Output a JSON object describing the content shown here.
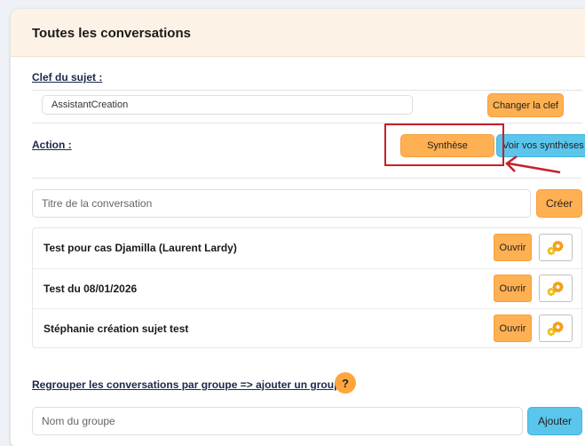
{
  "panel": {
    "title": "Toutes les conversations"
  },
  "subject": {
    "label": "Clef du sujet :",
    "value": "AssistantCreation",
    "change_button": "Changer la clef"
  },
  "action": {
    "label": "Action :",
    "synthesis_button": "Synthèse",
    "view_syntheses_button": "Voir vos synthèses"
  },
  "new_conversation": {
    "placeholder": "Titre de la conversation",
    "create_button": "Créer"
  },
  "conversations": [
    {
      "title": "Test pour cas Djamilla (Laurent Lardy)",
      "open_label": "Ouvrir",
      "icon": "gears-icon"
    },
    {
      "title": "Test du 08/01/2026",
      "open_label": "Ouvrir",
      "icon": "gears-icon"
    },
    {
      "title": "Stéphanie création sujet test",
      "open_label": "Ouvrir",
      "icon": "gears-icon"
    }
  ],
  "group": {
    "link": "Regrouper les conversations par groupe => ajouter un groupe",
    "help": "?",
    "placeholder": "Nom du groupe",
    "add_button": "Ajouter"
  },
  "colors": {
    "accent_orange": "#ffb052",
    "accent_blue": "#5bc5ec",
    "highlight_red": "#c6202a",
    "header_bg": "#fdf2e6"
  }
}
